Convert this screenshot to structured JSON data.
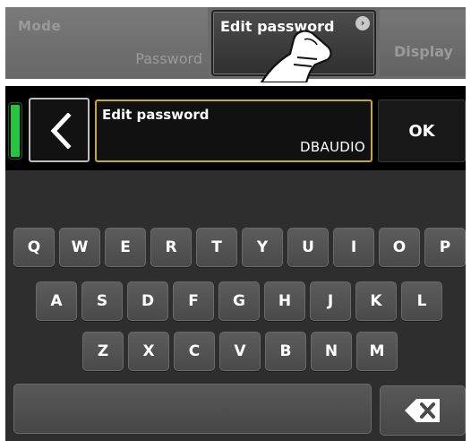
{
  "top": {
    "mode_label": "Mode",
    "mode_value": "Password",
    "edit_password_label": "Edit password",
    "chevron_glyph": "›",
    "display_label": "Display"
  },
  "editor": {
    "back_glyph": "<",
    "field_label": "Edit password",
    "field_value": "DBAUDIO",
    "ok_label": "OK",
    "status_led_color": "#27c440"
  },
  "keyboard": {
    "row1": [
      "Q",
      "W",
      "E",
      "R",
      "T",
      "Y",
      "U",
      "I",
      "O",
      "P"
    ],
    "row2": [
      "A",
      "S",
      "D",
      "F",
      "G",
      "H",
      "J",
      "K",
      "L"
    ],
    "row3": [
      "Z",
      "X",
      "C",
      "V",
      "B",
      "N",
      "M"
    ],
    "backspace_icon": "backspace-icon"
  }
}
